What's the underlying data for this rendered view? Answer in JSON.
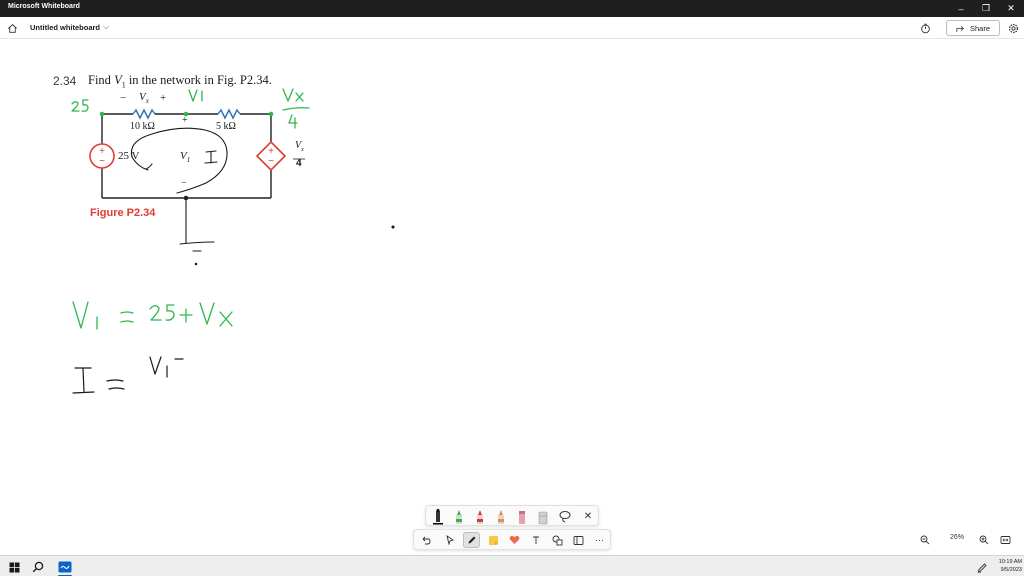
{
  "window": {
    "app_title": "Microsoft Whiteboard",
    "minimize": "–",
    "restore": "❐",
    "close": "✕"
  },
  "header": {
    "board_title": "Untitled whiteboard",
    "title_chevron": "⌵",
    "share_label": "Share"
  },
  "problem": {
    "number": "2.34",
    "text_before": "Find ",
    "var_v": "V",
    "var_sub": "1",
    "text_after": " in the network in Fig. P2.34.",
    "figure_caption": "Figure P2.34"
  },
  "circuit": {
    "r1_label": "10 kΩ",
    "r2_label": "5 kΩ",
    "source_label": "25 V",
    "vx_minus": "−",
    "vx_plus": "+",
    "vx_label": "V",
    "vx_sub": "x",
    "node_plus": "+",
    "node_minus": "−",
    "v1_label": "V",
    "v1_sub": "1",
    "dep_num": "V",
    "dep_num_sub": "x",
    "dep_den": "4"
  },
  "ink": {
    "green": "#2db84c",
    "black": "#1a1a1a"
  },
  "zoom": {
    "level": "26%"
  },
  "taskbar": {
    "time": "10:19 AM",
    "date": "9/5/2023"
  },
  "colors": {
    "titlebar": "#1f1f1f",
    "figure_red": "#e03c31",
    "resistor_blue": "#2f6db5",
    "accent_blue": "#0a64c8"
  }
}
